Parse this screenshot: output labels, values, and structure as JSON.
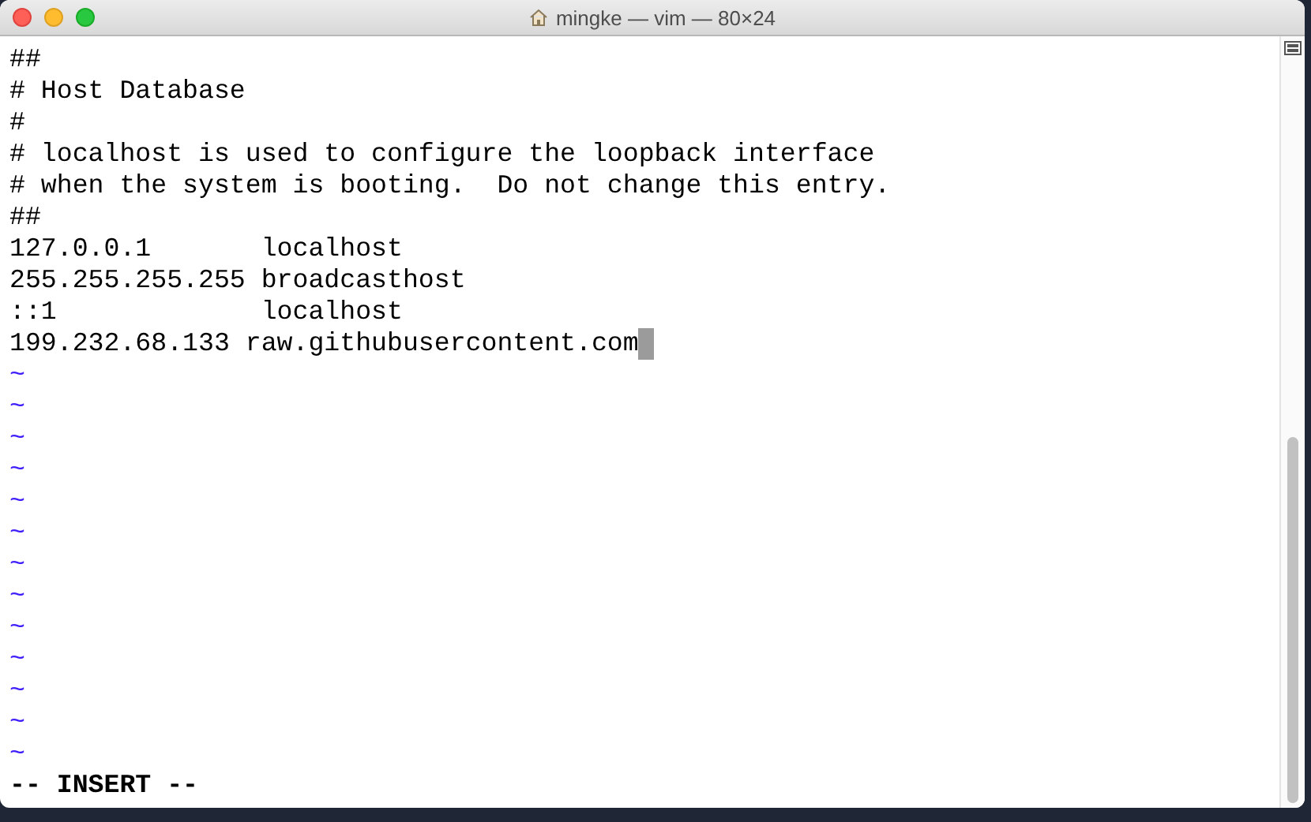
{
  "window": {
    "title": "mingke — vim — 80×24"
  },
  "lines": [
    {
      "kind": "text",
      "text": "##",
      "cursor": false
    },
    {
      "kind": "text",
      "text": "# Host Database",
      "cursor": false
    },
    {
      "kind": "text",
      "text": "#",
      "cursor": false
    },
    {
      "kind": "text",
      "text": "# localhost is used to configure the loopback interface",
      "cursor": false
    },
    {
      "kind": "text",
      "text": "# when the system is booting.  Do not change this entry.",
      "cursor": false
    },
    {
      "kind": "text",
      "text": "##",
      "cursor": false
    },
    {
      "kind": "text",
      "text": "127.0.0.1       localhost",
      "cursor": false
    },
    {
      "kind": "text",
      "text": "255.255.255.255 broadcasthost",
      "cursor": false
    },
    {
      "kind": "text",
      "text": "::1             localhost",
      "cursor": false
    },
    {
      "kind": "text",
      "text": "199.232.68.133 raw.githubusercontent.com",
      "cursor": true
    },
    {
      "kind": "filler",
      "text": "~"
    },
    {
      "kind": "filler",
      "text": "~"
    },
    {
      "kind": "filler",
      "text": "~"
    },
    {
      "kind": "filler",
      "text": "~"
    },
    {
      "kind": "filler",
      "text": "~"
    },
    {
      "kind": "filler",
      "text": "~"
    },
    {
      "kind": "filler",
      "text": "~"
    },
    {
      "kind": "filler",
      "text": "~"
    },
    {
      "kind": "filler",
      "text": "~"
    },
    {
      "kind": "filler",
      "text": "~"
    },
    {
      "kind": "filler",
      "text": "~"
    },
    {
      "kind": "filler",
      "text": "~"
    },
    {
      "kind": "filler",
      "text": "~"
    }
  ],
  "status_line": "-- INSERT --"
}
